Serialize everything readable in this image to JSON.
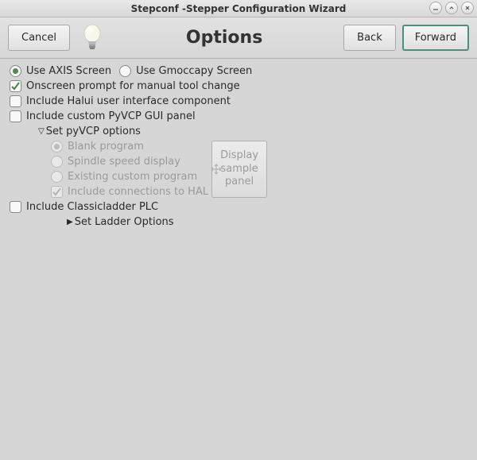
{
  "window": {
    "title": "Stepconf -Stepper Configuration Wizard"
  },
  "header": {
    "cancel": "Cancel",
    "title": "Options",
    "back": "Back",
    "forward": "Forward"
  },
  "screen": {
    "axis": "Use AXIS Screen",
    "gmoccapy": "Use Gmoccapy Screen"
  },
  "opts": {
    "onscreen_prompt": "Onscreen prompt for manual tool change",
    "halui": "Include Halui user interface component",
    "pyvcp": "Include custom PyVCP GUI panel",
    "classicladder": "Include Classicladder PLC"
  },
  "pyvcp": {
    "expander": "Set pyVCP options",
    "blank": "Blank program",
    "spindle": "Spindle speed display",
    "existing": "Existing custom program",
    "hal": "Include connections to HAL",
    "sample_btn": "Display sample panel"
  },
  "ladder": {
    "expander": "Set Ladder Options"
  }
}
